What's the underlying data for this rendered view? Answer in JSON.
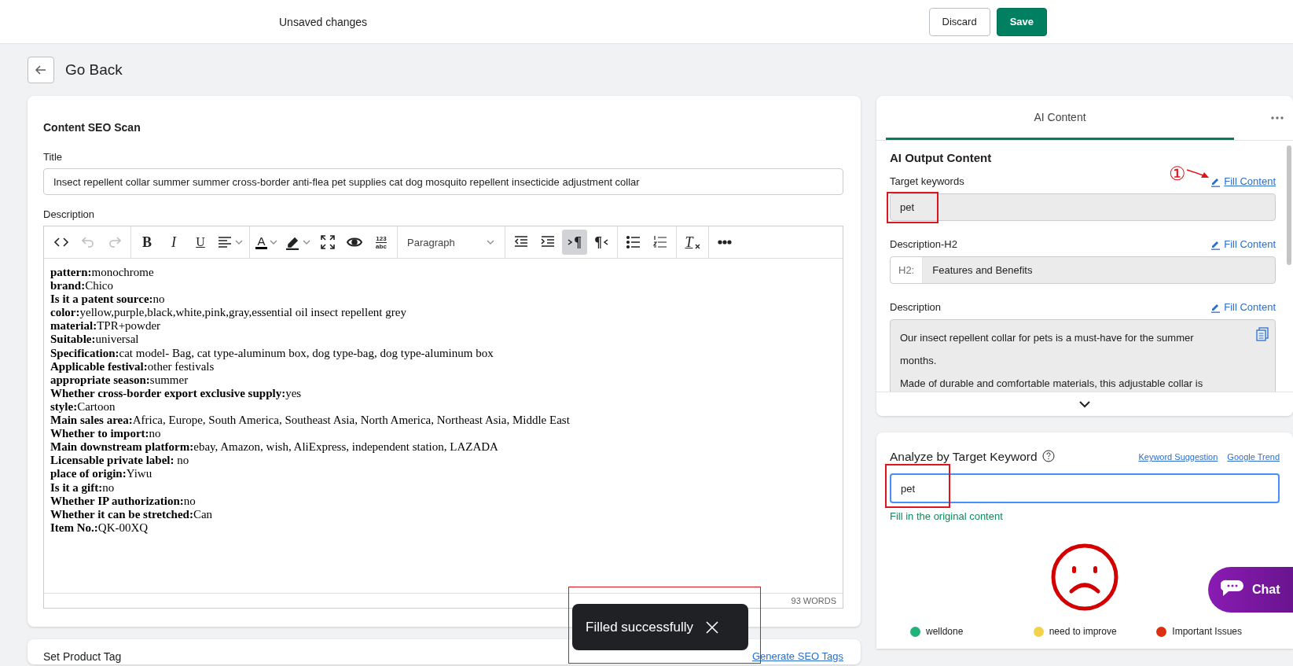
{
  "top_bar": {
    "title": "Unsaved changes",
    "buttons": [
      {
        "label": "Discard",
        "kind": "secondary"
      },
      {
        "label": "Save",
        "kind": "primary"
      }
    ]
  },
  "back": {
    "label": "Go Back"
  },
  "seo_card": {
    "title": "Content SEO Scan",
    "title_field": {
      "label": "Title",
      "value": "Insect repellent collar summer summer cross-border anti-flea pet supplies cat dog mosquito repellent insecticide adjustment collar"
    },
    "description": {
      "label": "Description",
      "format": "Paragraph",
      "word_count": "93 WORDS",
      "toolbar": [
        [
          {
            "kind": "code",
            "selected": false,
            "disabled": false
          },
          {
            "kind": "undo",
            "selected": false,
            "disabled": true
          },
          {
            "kind": "redo",
            "selected": false,
            "disabled": true
          }
        ],
        [
          {
            "kind": "bold",
            "label": "B",
            "selected": false,
            "disabled": false
          },
          {
            "kind": "italic",
            "label": "I",
            "selected": false,
            "disabled": false
          },
          {
            "kind": "underline",
            "label": "U",
            "selected": false,
            "disabled": false
          },
          {
            "kind": "align",
            "selected": false,
            "disabled": false
          }
        ],
        [
          {
            "kind": "font-color",
            "label": "A",
            "selected": false,
            "disabled": false
          },
          {
            "kind": "highlight",
            "selected": false,
            "disabled": false
          },
          {
            "kind": "fullscreen",
            "selected": false,
            "disabled": false
          },
          {
            "kind": "preview",
            "selected": false,
            "disabled": false
          },
          {
            "kind": "word-count",
            "lines": [
              "123",
              "abc"
            ],
            "selected": false,
            "disabled": false
          }
        ],
        [
          {
            "kind": "format",
            "selected": false,
            "disabled": false
          }
        ],
        [
          {
            "kind": "outdent",
            "selected": false,
            "disabled": false
          },
          {
            "kind": "indent",
            "selected": false,
            "disabled": false
          },
          {
            "kind": "ltr",
            "label": "¶",
            "selected": true,
            "disabled": false
          },
          {
            "kind": "rtl",
            "label": "¶",
            "selected": false,
            "disabled": false
          }
        ],
        [
          {
            "kind": "bullets",
            "selected": false,
            "disabled": false
          },
          {
            "kind": "numbers",
            "selected": false,
            "disabled": false
          }
        ],
        [
          {
            "kind": "clear",
            "label": "T",
            "selected": false,
            "disabled": false
          }
        ],
        [
          {
            "kind": "more",
            "selected": false,
            "disabled": false
          }
        ]
      ],
      "lines": [
        "**pattern:**monochrome",
        "**brand:**Chico",
        "**Is it a patent source:**no",
        "**color:**yellow,purple,black,white,pink,gray,essential oil insect repellent grey",
        "**material:**TPR+powder",
        "**Suitable:**universal",
        "**Specification:**cat model- Bag, cat type-aluminum box, dog type-bag, dog type-aluminum box",
        "**Applicable festival:**other festivals",
        "**appropriate season:**summer",
        "**Whether cross-border export exclusive supply:**yes",
        "**style:**Cartoon",
        "**Main sales area:**Africa, Europe, South America, Southeast Asia, North America, Northeast Asia, Middle East",
        "**Whether to import:**no",
        "**Main downstream platform:**ebay, Amazon, wish, AliExpress, independent station, LAZADA",
        "**Licensable private label:** no",
        "**place of origin:**Yiwu",
        "**Is it a gift:**no",
        "**Whether IP authorization:**no",
        "**Whether it can be stretched:**Can",
        "**Item No.:**QK-00XQ"
      ]
    }
  },
  "tag_card": {
    "title": "Set Product Tag",
    "link": "Generate SEO Tags"
  },
  "ai_panel": {
    "tabs": [
      {
        "label": "AI Content",
        "selected": true
      }
    ],
    "heading": "AI Output Content",
    "fields": [
      {
        "kind": "keywords",
        "label": "Target keywords",
        "link": {
          "label": "Fill Content",
          "hovered": true,
          "callout": "①"
        },
        "value": "pet",
        "highlighted": true
      },
      {
        "kind": "prefixed",
        "label": "Description-H2",
        "link": {
          "label": "Fill Content",
          "hovered": false
        },
        "prefix": "H2:",
        "value": "Features and Benefits",
        "highlighted": false
      },
      {
        "kind": "textarea",
        "label": "Description",
        "link": {
          "label": "Fill Content",
          "hovered": false
        },
        "paragraphs": [
          "Our insect repellent collar for pets is a must-have for the summer months.",
          "Made of durable and comfortable materials, this adjustable collar is"
        ],
        "highlighted": false
      }
    ]
  },
  "analyze": {
    "title": "Analyze by Target Keyword",
    "links": [
      "Keyword Suggestion",
      "Google Trend"
    ],
    "input": {
      "value": "pet",
      "focused": true,
      "highlighted": true
    },
    "hint": "Fill in the original content",
    "legend": [
      {
        "label": "welldone",
        "color": "#1fb37a"
      },
      {
        "label": "need to improve",
        "color": "#f2d24b"
      },
      {
        "label": "Important Issues",
        "color": "#d9310f"
      }
    ]
  },
  "toast": {
    "message": "Filled successfully",
    "highlighted": true
  },
  "chat": {
    "label": "Chat"
  }
}
